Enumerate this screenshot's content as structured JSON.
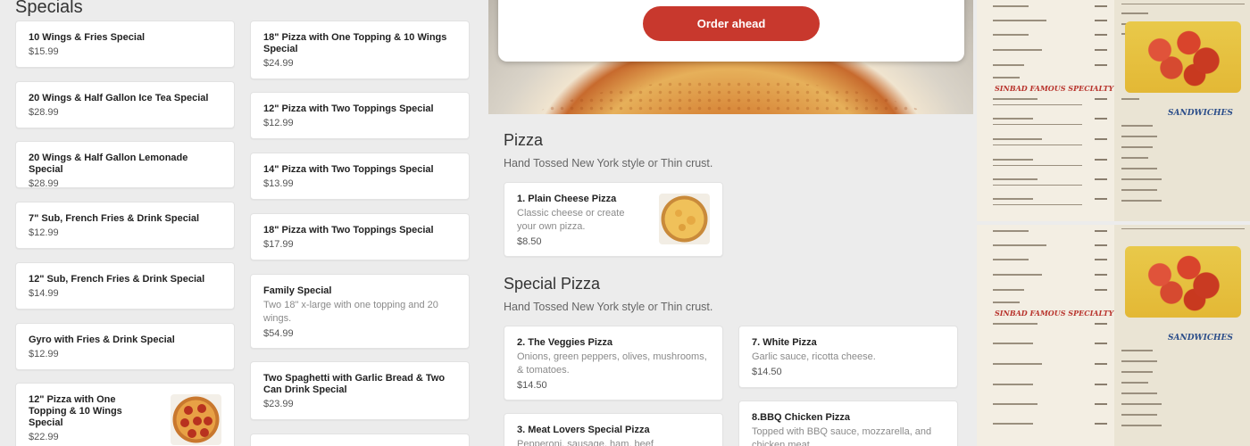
{
  "specials": {
    "title": "Specials",
    "col1": [
      {
        "name": "10 Wings & Fries Special",
        "price": "$15.99"
      },
      {
        "name": "20 Wings & Half Gallon Ice Tea Special",
        "price": "$28.99"
      },
      {
        "name": "20 Wings & Half Gallon Lemonade Special",
        "price": "$28.99"
      },
      {
        "name": "7\" Sub, French Fries & Drink Special",
        "price": "$12.99"
      },
      {
        "name": "12\" Sub, French Fries & Drink Special",
        "price": "$14.99"
      },
      {
        "name": "Gyro with Fries & Drink Special",
        "price": "$12.99"
      },
      {
        "name": "12\" Pizza with One Topping & 10 Wings Special",
        "price": "$22.99"
      }
    ],
    "col2": [
      {
        "name": "18\" Pizza with One Topping & 10 Wings Special",
        "price": "$24.99"
      },
      {
        "name": "12\" Pizza with Two Toppings Special",
        "price": "$12.99"
      },
      {
        "name": "14\" Pizza with Two Toppings Special",
        "price": "$13.99"
      },
      {
        "name": "18\" Pizza with Two Toppings Special",
        "price": "$17.99"
      },
      {
        "name": "Family Special",
        "desc": "Two 18\" x-large with one topping and 20 wings.",
        "price": "$54.99"
      },
      {
        "name": "Two Spaghetti with Garlic Bread & Two Can Drink Special",
        "price": "$23.99"
      }
    ]
  },
  "order": {
    "button_label": "Order ahead"
  },
  "pizza": {
    "title": "Pizza",
    "subtitle": "Hand Tossed New York style or Thin crust.",
    "items": [
      {
        "name": "1. Plain Cheese Pizza",
        "desc": "Classic cheese or create your own pizza.",
        "price": "$8.50"
      }
    ]
  },
  "special_pizza": {
    "title": "Special Pizza",
    "subtitle": "Hand Tossed New York style or Thin crust.",
    "items": [
      {
        "name": "2. The Veggies Pizza",
        "desc": "Onions, green peppers, olives, mushrooms, & tomatoes.",
        "price": "$14.50"
      },
      {
        "name": "7. White Pizza",
        "desc": "Garlic sauce, ricotta cheese.",
        "price": "$14.50"
      },
      {
        "name": "3. Meat Lovers Special Pizza",
        "desc": "Pepperoni, sausage, ham, beef"
      },
      {
        "name": "8.BBQ Chicken Pizza",
        "desc": "Topped with BBQ sauce, mozzarella, and chicken meat."
      }
    ]
  },
  "colors": {
    "accent": "#c8382d",
    "background": "#ececec",
    "card": "#ffffff"
  }
}
